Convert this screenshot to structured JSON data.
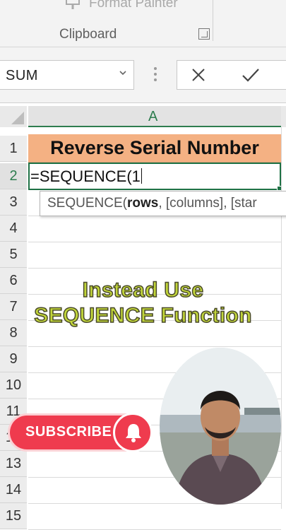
{
  "ribbon": {
    "format_painter_label": "Format Painter",
    "group_label": "Clipboard"
  },
  "formula_bar": {
    "name_box_value": "SUM"
  },
  "sheet": {
    "column_header": "A",
    "rows": [
      "1",
      "2",
      "3",
      "4",
      "5",
      "6",
      "7",
      "8",
      "9",
      "10",
      "11",
      "12",
      "13",
      "14",
      "15"
    ],
    "header_cell_text": "Reverse Serial Number",
    "active_cell_text": "=SEQUENCE(1"
  },
  "tooltip": {
    "func": "SEQUENCE(",
    "arg_bold": "rows",
    "args_rest": ", [columns], [star"
  },
  "overlay": {
    "line1": "Instead Use",
    "line2": "SEQUENCE Function"
  },
  "subscribe": {
    "label": "SUBSCRIBE"
  },
  "colors": {
    "header_fill": "#f4b183",
    "active_border": "#1e7145",
    "overlay_text": "#c2d63a",
    "subscribe_red": "#ef3b4e"
  }
}
